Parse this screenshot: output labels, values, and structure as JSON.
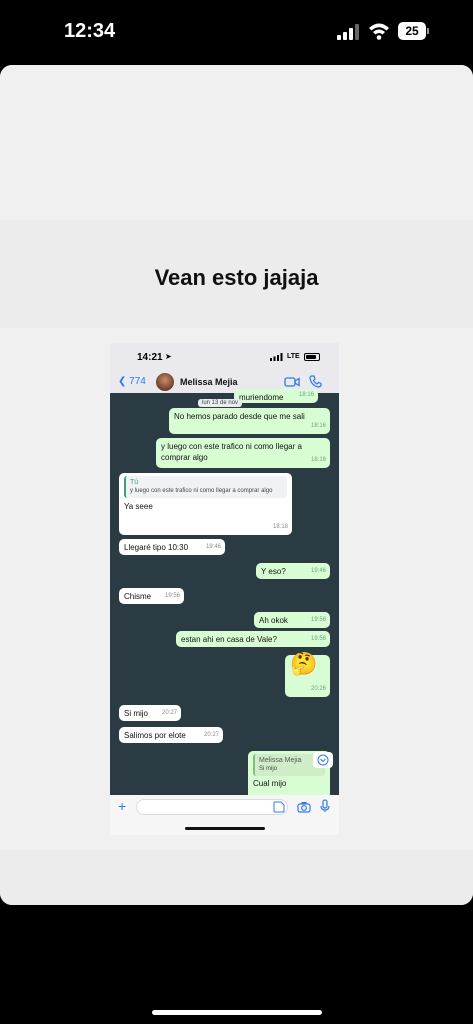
{
  "status_bar": {
    "time": "12:34",
    "battery": "25"
  },
  "caption": "Vean esto jajaja",
  "screenshot": {
    "time": "14:21",
    "network": "LTE",
    "back_count": "774",
    "contact": "Melissa Mejia",
    "date_chip": "lun 13 de nov",
    "messages": [
      {
        "dir": "out",
        "text": "muriendome",
        "time": "18:16"
      },
      {
        "dir": "out",
        "text": "No hemos parado desde que me sali",
        "time": "18:16"
      },
      {
        "dir": "out",
        "text": "y luego con este trafico ni como llegar a comprar algo",
        "time": "18:16"
      },
      {
        "dir": "in",
        "quote_name": "Tú",
        "quote_text": "y luego con este trafico ni como llegar a comprar algo",
        "text": "Ya seee",
        "time": "18:18"
      },
      {
        "dir": "in",
        "text": "Llegaré tipo 10:30",
        "time": "19:46"
      },
      {
        "dir": "out",
        "text": "Y eso?",
        "time": "19:46"
      },
      {
        "dir": "in",
        "text": "Chisme",
        "time": "19:56"
      },
      {
        "dir": "out",
        "text": "Ah okok",
        "time": "19:56"
      },
      {
        "dir": "out",
        "text": "estan ahi en casa de Vale?",
        "time": "19:56"
      },
      {
        "dir": "out",
        "text": "🤔",
        "time": "20:26"
      },
      {
        "dir": "in",
        "text": "Si mijo",
        "time": "20:27"
      },
      {
        "dir": "in",
        "text": "Salimos por elote",
        "time": "20:27"
      },
      {
        "dir": "out",
        "quote_name": "Melissa Mejia",
        "quote_text": "Si mijo",
        "text": "Cual mijo"
      }
    ]
  },
  "colors": {
    "chat_bg": "#2a3b44",
    "outgoing": "#d9fdd3",
    "incoming": "#ffffff",
    "accent": "#2c7be5"
  }
}
